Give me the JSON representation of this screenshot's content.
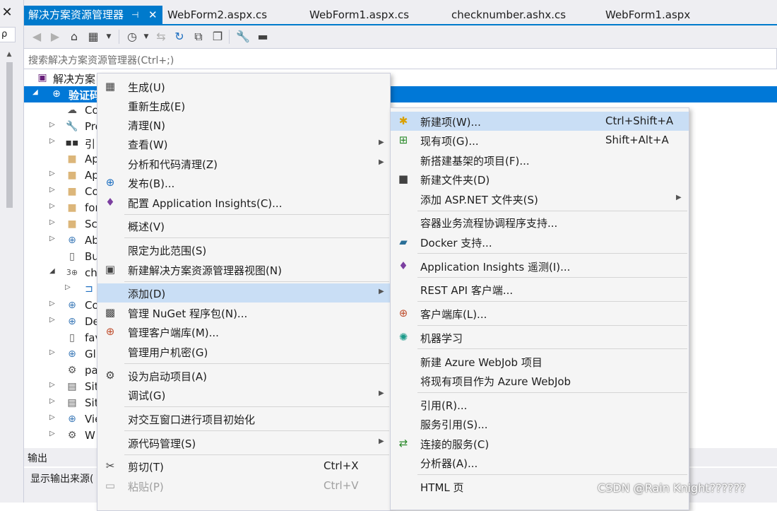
{
  "colors": {
    "accent": "#007acc",
    "selection": "#0078d7",
    "menu_highlight": "#c9def5",
    "menu_bg": "#f5f5f5",
    "chrome_bg": "#eeeef2"
  },
  "left_panel": {
    "close_glyph": "✕",
    "search_fragment": "ρ"
  },
  "tabs": [
    {
      "label": "解决方案资源管理器",
      "active": true,
      "pin_glyph": "⊣",
      "close_glyph": "✕"
    },
    {
      "label": "WebForm2.aspx.cs"
    },
    {
      "label": "WebForm1.aspx.cs"
    },
    {
      "label": "checknumber.ashx.cs"
    },
    {
      "label": "WebForm1.aspx"
    }
  ],
  "toolbar": {
    "icons": [
      "back-arrow-icon",
      "forward-arrow-icon",
      "home-icon",
      "switch-views-icon",
      "dropdown-arrow-icon",
      "pending-changes-icon",
      "dropdown-arrow-icon",
      "sync-icon",
      "refresh-icon",
      "collapse-all-icon",
      "show-all-files-icon",
      "properties-wrench-icon",
      "preview-icon"
    ]
  },
  "search": {
    "placeholder": "搜索解决方案资源管理器(Ctrl+;)"
  },
  "tree": {
    "items": [
      {
        "label": "解决方案",
        "icon": "solution-icon"
      },
      {
        "label": "验证码",
        "icon": "globe-project-icon",
        "selected": true
      },
      {
        "label": "Co",
        "icon": "connected-services-icon"
      },
      {
        "label": "Pro",
        "icon": "wrench-icon"
      },
      {
        "label": "引",
        "icon": "references-icon"
      },
      {
        "label": "Ap",
        "icon": "folder-icon"
      },
      {
        "label": "Ap",
        "icon": "folder-icon"
      },
      {
        "label": "Co",
        "icon": "folder-icon"
      },
      {
        "label": "for",
        "icon": "folder-icon"
      },
      {
        "label": "Sc",
        "icon": "folder-icon"
      },
      {
        "label": "Ab",
        "icon": "globe-file-icon"
      },
      {
        "label": "Bu",
        "icon": "cs-file-icon"
      },
      {
        "label": "ch",
        "icon": "ashx-file-icon"
      },
      {
        "label": "",
        "icon": "cs-file-icon"
      },
      {
        "label": "Co",
        "icon": "globe-file-icon"
      },
      {
        "label": "De",
        "icon": "globe-file-icon"
      },
      {
        "label": "fav",
        "icon": "favicon-file-icon"
      },
      {
        "label": "Gl",
        "icon": "global-asax-icon"
      },
      {
        "label": "pa",
        "icon": "config-file-icon"
      },
      {
        "label": "Sit",
        "icon": "master-page-icon"
      },
      {
        "label": "Sit",
        "icon": "master-page-icon"
      },
      {
        "label": "Vie",
        "icon": "globe-file-icon"
      },
      {
        "label": "W",
        "icon": "config-file-icon"
      }
    ]
  },
  "output": {
    "title": "输出",
    "source_label": "显示输出来源("
  },
  "context_menu": {
    "items": [
      {
        "label": "生成(U)",
        "icon": "build-icon"
      },
      {
        "label": "重新生成(E)"
      },
      {
        "label": "清理(N)"
      },
      {
        "label": "查看(W)",
        "arrow": "▶"
      },
      {
        "label": "分析和代码清理(Z)",
        "arrow": "▶"
      },
      {
        "label": "发布(B)...",
        "icon": "publish-globe-icon"
      },
      {
        "label": "配置 Application Insights(C)...",
        "icon": "app-insights-icon"
      },
      {
        "label": "概述(V)"
      },
      {
        "label": "限定为此范围(S)"
      },
      {
        "label": "新建解决方案资源管理器视图(N)",
        "icon": "new-view-icon"
      },
      {
        "label": "添加(D)",
        "arrow": "▶",
        "highlighted": true
      },
      {
        "label": "管理 NuGet 程序包(N)...",
        "icon": "nuget-icon"
      },
      {
        "label": "管理客户端库(M)...",
        "icon": "client-library-icon"
      },
      {
        "label": "管理用户机密(G)"
      },
      {
        "label": "设为启动项目(A)",
        "icon": "gear-icon"
      },
      {
        "label": "调试(G)",
        "arrow": "▶"
      },
      {
        "label": "对交互窗口进行项目初始化"
      },
      {
        "label": "源代码管理(S)",
        "arrow": "▶"
      },
      {
        "label": "剪切(T)",
        "shortcut": "Ctrl+X",
        "icon": "scissors-icon"
      },
      {
        "label": "粘贴(P)",
        "shortcut": "Ctrl+V",
        "icon": "paste-icon",
        "disabled": true
      }
    ]
  },
  "add_submenu": {
    "items": [
      {
        "label": "新建项(W)...",
        "shortcut": "Ctrl+Shift+A",
        "icon": "new-item-icon",
        "highlighted": true
      },
      {
        "label": "现有项(G)...",
        "shortcut": "Shift+Alt+A",
        "icon": "existing-item-icon"
      },
      {
        "label": "新搭建基架的项目(F)..."
      },
      {
        "label": "新建文件夹(D)",
        "icon": "new-folder-icon"
      },
      {
        "label": "添加 ASP.NET 文件夹(S)",
        "arrow": "▶"
      },
      {
        "label": "容器业务流程协调程序支持..."
      },
      {
        "label": "Docker 支持...",
        "icon": "docker-icon"
      },
      {
        "label": "Application Insights 遥测(I)...",
        "icon": "app-insights-icon"
      },
      {
        "label": "REST API 客户端..."
      },
      {
        "label": "客户端库(L)...",
        "icon": "client-library-icon"
      },
      {
        "label": "机器学习",
        "icon": "machine-learning-icon"
      },
      {
        "label": "新建 Azure WebJob 项目"
      },
      {
        "label": "将现有项目作为 Azure WebJob"
      },
      {
        "label": "引用(R)..."
      },
      {
        "label": "服务引用(S)..."
      },
      {
        "label": "连接的服务(C)",
        "icon": "connected-services-icon"
      },
      {
        "label": "分析器(A)..."
      },
      {
        "label": "HTML 页"
      }
    ]
  },
  "watermark": "CSDN @Rain Knight??????"
}
